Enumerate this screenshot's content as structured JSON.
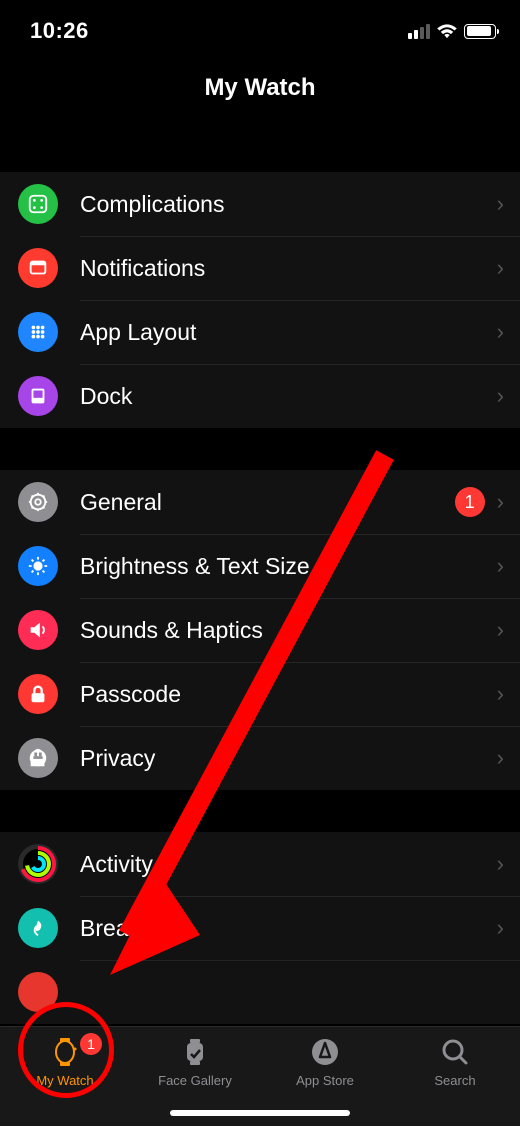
{
  "status": {
    "time": "10:26"
  },
  "header": {
    "title": "My Watch"
  },
  "sections": [
    {
      "rows": [
        {
          "label": "Complications"
        },
        {
          "label": "Notifications"
        },
        {
          "label": "App Layout"
        },
        {
          "label": "Dock"
        }
      ]
    },
    {
      "rows": [
        {
          "label": "General",
          "badge": "1"
        },
        {
          "label": "Brightness & Text Size"
        },
        {
          "label": "Sounds & Haptics"
        },
        {
          "label": "Passcode"
        },
        {
          "label": "Privacy"
        }
      ]
    },
    {
      "rows": [
        {
          "label": "Activity"
        },
        {
          "label": "Breathe"
        }
      ]
    }
  ],
  "tabbar": {
    "items": [
      {
        "label": "My Watch",
        "badge": "1"
      },
      {
        "label": "Face Gallery"
      },
      {
        "label": "App Store"
      },
      {
        "label": "Search"
      }
    ]
  }
}
